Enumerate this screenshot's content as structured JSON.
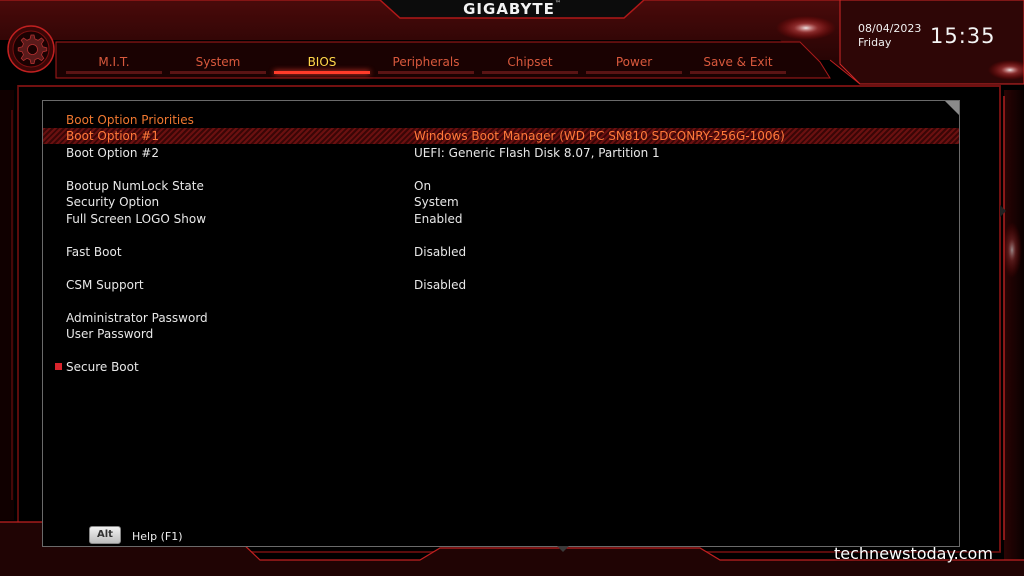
{
  "header": {
    "brand": "GIGABYTE",
    "brand_tm": "™",
    "date": "08/04/2023",
    "day": "Friday",
    "time": "15:35"
  },
  "tabs": [
    {
      "label": "M.I.T.",
      "active": false
    },
    {
      "label": "System",
      "active": false
    },
    {
      "label": "BIOS",
      "active": true
    },
    {
      "label": "Peripherals",
      "active": false
    },
    {
      "label": "Chipset",
      "active": false
    },
    {
      "label": "Power",
      "active": false
    },
    {
      "label": "Save & Exit",
      "active": false
    }
  ],
  "settings": {
    "section_title": "Boot Option Priorities",
    "boot1_label": "Boot Option #1",
    "boot1_value": "Windows Boot Manager (WD PC SN810 SDCQNRY-256G-1006)",
    "boot2_label": "Boot Option #2",
    "boot2_value": "UEFI: Generic Flash Disk 8.07, Partition 1",
    "numlock_label": "Bootup NumLock State",
    "numlock_value": "On",
    "security_label": "Security Option",
    "security_value": "System",
    "logo_label": "Full Screen LOGO Show",
    "logo_value": "Enabled",
    "fastboot_label": "Fast Boot",
    "fastboot_value": "Disabled",
    "csm_label": "CSM Support",
    "csm_value": "Disabled",
    "admin_pw_label": "Administrator Password",
    "user_pw_label": "User Password",
    "secure_boot_label": "Secure Boot"
  },
  "footer": {
    "alt_key": "Alt",
    "help_label": "Help (F1)"
  },
  "watermark": "technewstoday.com",
  "colors": {
    "accent_red": "#d8242c",
    "active_tab": "#ffd84a",
    "tab_text": "#d9593d",
    "section_title": "#f07830",
    "selected_text": "#ff7a3a"
  }
}
